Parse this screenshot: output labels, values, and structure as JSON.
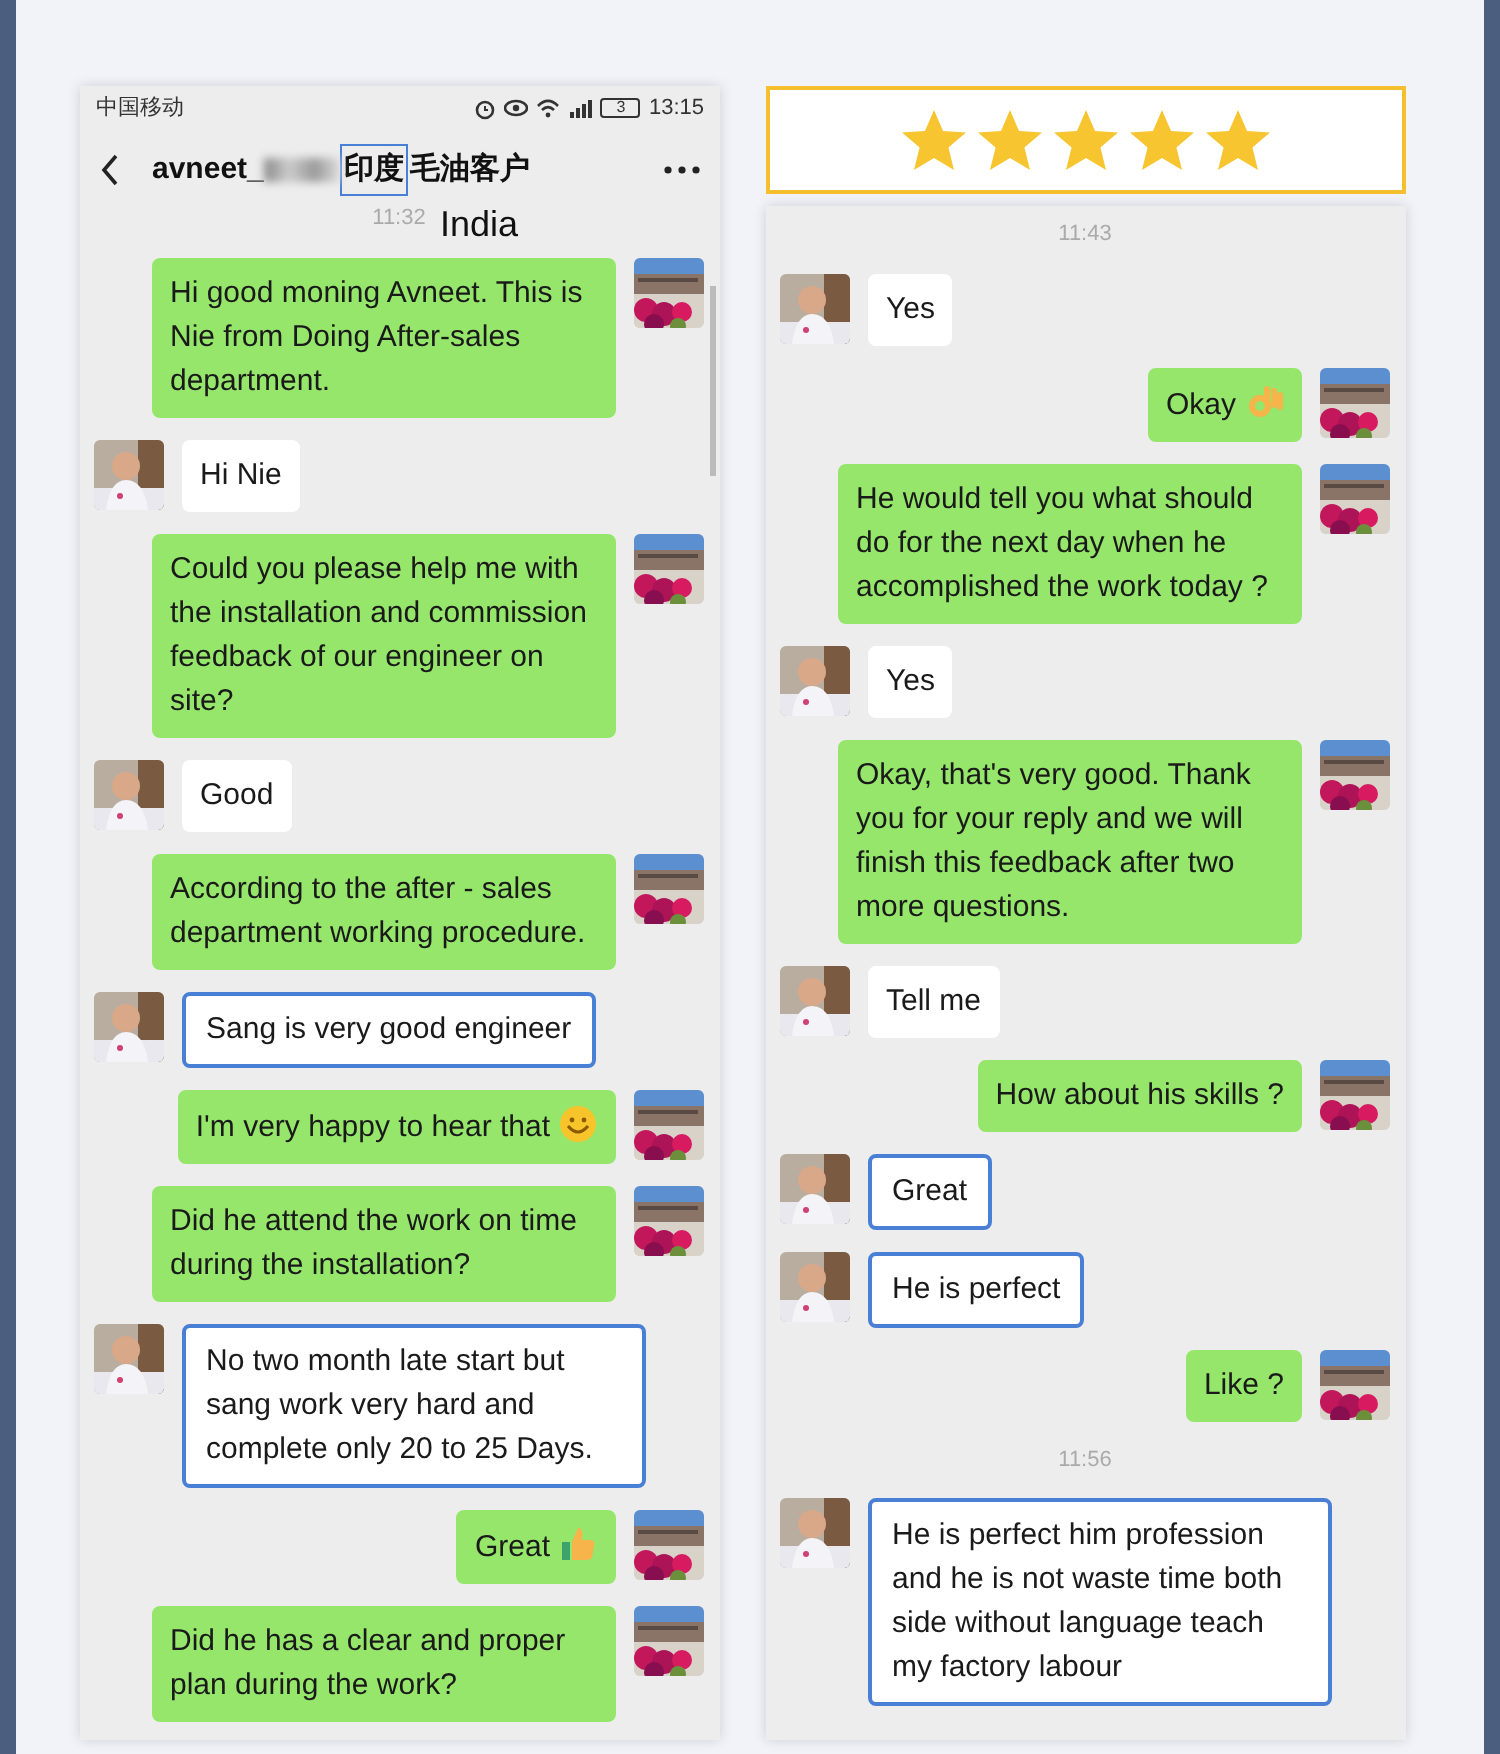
{
  "left_phone": {
    "status_bar": {
      "carrier": "中国移动",
      "battery": "3",
      "time": "13:15"
    },
    "header": {
      "title_start": "avneet_",
      "title_highlight": "印度",
      "title_end": "毛油客户",
      "annotation": "India"
    },
    "entries": [
      {
        "kind": "time",
        "text": "11:32"
      },
      {
        "kind": "sent",
        "text": "Hi good moning Avneet. This is Nie from Doing After-sales department.",
        "highlighted": false
      },
      {
        "kind": "received",
        "text": "Hi Nie",
        "highlighted": false
      },
      {
        "kind": "sent",
        "text": "Could you please help me with the installation and commission feedback of our engineer on site?",
        "highlighted": false
      },
      {
        "kind": "received",
        "text": "Good",
        "highlighted": false
      },
      {
        "kind": "sent",
        "text": "According to the after - sales department working procedure.",
        "highlighted": false
      },
      {
        "kind": "received",
        "text": "Sang is very good engineer",
        "highlighted": true
      },
      {
        "kind": "sent",
        "text": "I'm very happy to hear that",
        "emoji": {
          "kind": "smile"
        },
        "highlighted": false
      },
      {
        "kind": "sent",
        "text": "Did he attend the work on time during the installation?",
        "highlighted": false
      },
      {
        "kind": "received",
        "text": "No two month late start but sang work very hard and complete only 20 to 25 Days.",
        "highlighted": true
      },
      {
        "kind": "sent",
        "text": "Great",
        "emoji": {
          "kind": "thumb"
        },
        "highlighted": false
      },
      {
        "kind": "sent",
        "text": "Did he has a clear and proper plan during the work?",
        "highlighted": false
      }
    ]
  },
  "rating": {
    "stars": 5
  },
  "right_phone": {
    "entries": [
      {
        "kind": "time",
        "text": "11:43"
      },
      {
        "kind": "received",
        "text": "Yes",
        "highlighted": false
      },
      {
        "kind": "sent",
        "text": "Okay",
        "emoji": {
          "kind": "ok"
        },
        "highlighted": false
      },
      {
        "kind": "sent",
        "text": "He would tell you what should do for the next day when he accomplished the work today ?",
        "highlighted": false
      },
      {
        "kind": "received",
        "text": "Yes",
        "highlighted": false
      },
      {
        "kind": "sent",
        "text": "Okay, that's very good. Thank you for your reply and we will finish this feedback after two more questions.",
        "highlighted": false
      },
      {
        "kind": "received",
        "text": "Tell me",
        "highlighted": false
      },
      {
        "kind": "sent",
        "text": "How about his skills ?",
        "highlighted": false
      },
      {
        "kind": "received",
        "text": "Great",
        "highlighted": true
      },
      {
        "kind": "received",
        "text": "He is perfect",
        "highlighted": true
      },
      {
        "kind": "sent",
        "text": "Like ?",
        "highlighted": false
      },
      {
        "kind": "time",
        "text": "11:56"
      },
      {
        "kind": "received",
        "text": "He is perfect him profession and he is not waste time both side without language teach my factory labour",
        "highlighted": true
      }
    ]
  }
}
